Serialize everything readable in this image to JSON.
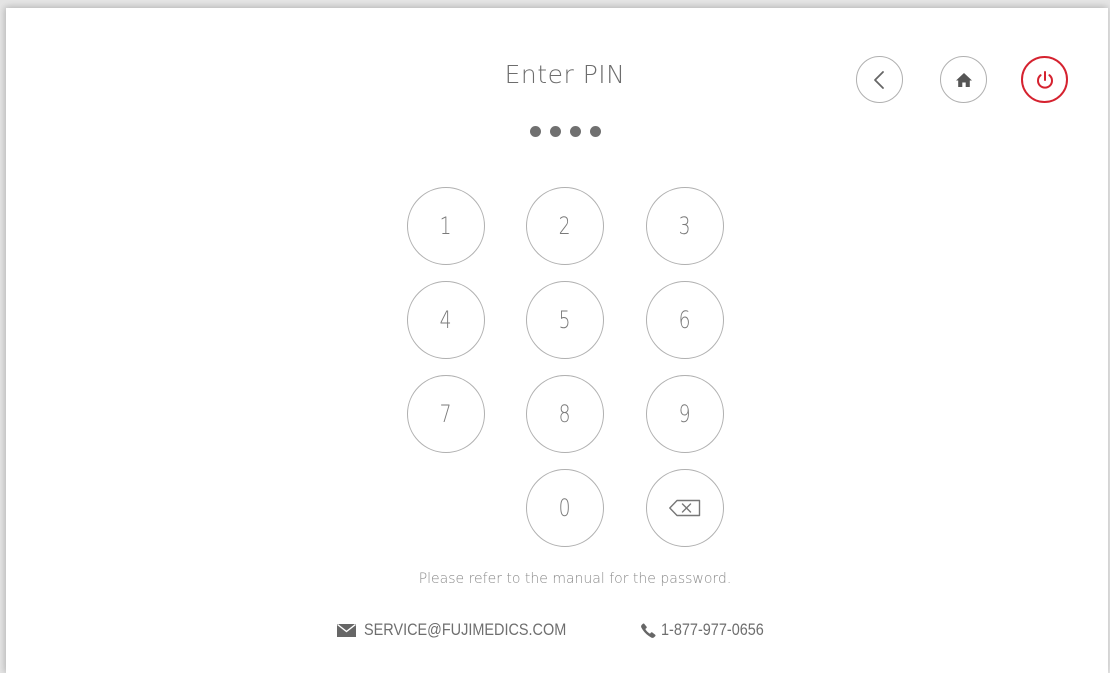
{
  "header": {
    "title": "Enter PIN",
    "pin_length": 4
  },
  "nav": {
    "back_icon": "chevron-left-icon",
    "home_icon": "home-icon",
    "power_icon": "power-icon",
    "power_color": "#d5222f"
  },
  "keypad": {
    "keys": [
      "1",
      "2",
      "3",
      "4",
      "5",
      "6",
      "7",
      "8",
      "9",
      "0"
    ],
    "backspace_icon": "backspace-icon"
  },
  "footer": {
    "note": "Please refer to the manual for the password.",
    "email": "SERVICE@FUJIMEDICS.COM",
    "phone": "1-877-977-0656",
    "email_icon": "envelope-icon",
    "phone_icon": "phone-icon"
  }
}
